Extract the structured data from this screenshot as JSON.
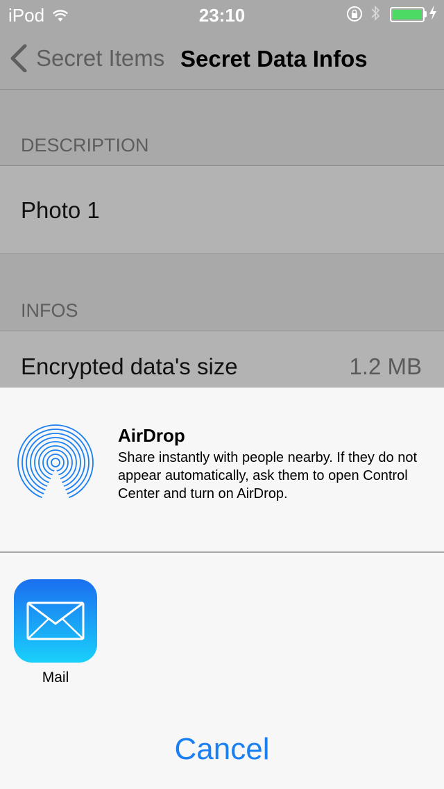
{
  "status_bar": {
    "carrier": "iPod",
    "time": "23:10",
    "wifi_icon": "wifi-icon",
    "lock_icon": "rotation-lock-icon",
    "bluetooth_icon": "bluetooth-icon",
    "battery_icon": "battery-icon",
    "charging_icon": "charging-bolt-icon",
    "battery_color": "#4cd964"
  },
  "nav": {
    "back_label": "Secret Items",
    "title": "Secret Data Infos",
    "back_icon": "chevron-left-icon"
  },
  "sections": {
    "description_header": "DESCRIPTION",
    "description_value": "Photo 1",
    "infos_header": "INFOS",
    "size_label": "Encrypted data's size",
    "size_value": "1.2 MB"
  },
  "share_sheet": {
    "airdrop": {
      "title": "AirDrop",
      "description": "Share instantly with people nearby. If they do not appear automatically, ask them to open Control Center and turn on AirDrop.",
      "icon": "airdrop-icon",
      "color": "#1a7ff2"
    },
    "apps": [
      {
        "label": "Mail",
        "icon": "mail-icon"
      }
    ],
    "cancel_label": "Cancel",
    "accent_color": "#1a7ff2"
  }
}
